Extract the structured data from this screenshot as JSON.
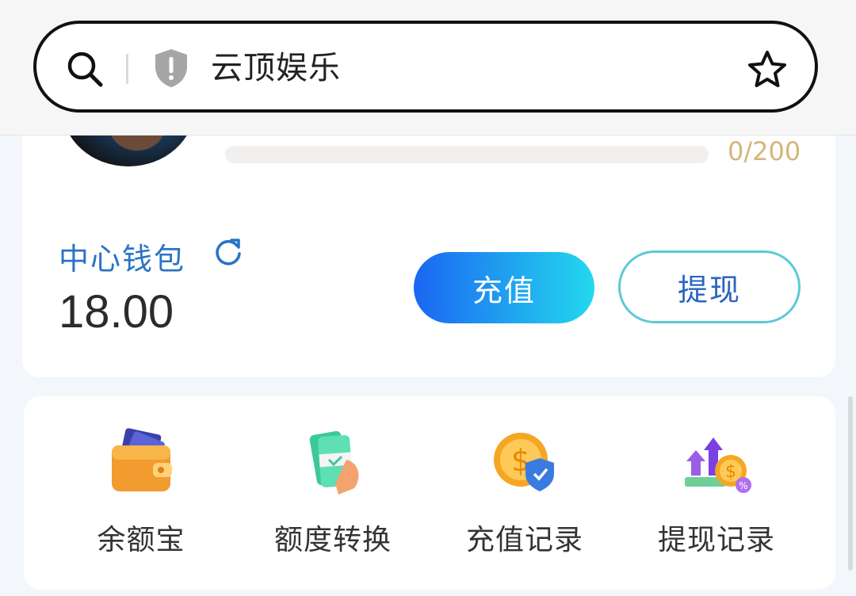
{
  "browser": {
    "url_text": "云顶娱乐",
    "icons": {
      "search": "search-icon",
      "security": "shield-icon",
      "bookmark": "star-icon"
    }
  },
  "profile": {
    "progress_text": "0/200",
    "progress_fraction": 0
  },
  "wallet": {
    "label": "中心钱包",
    "balance": "18.00",
    "recharge_label": "充值",
    "withdraw_label": "提现"
  },
  "menu": {
    "items": [
      {
        "label": "余额宝",
        "icon": "wallet-icon"
      },
      {
        "label": "额度转换",
        "icon": "money-hand-icon"
      },
      {
        "label": "充值记录",
        "icon": "coin-shield-icon"
      },
      {
        "label": "提现记录",
        "icon": "growth-coins-icon"
      }
    ]
  },
  "colors": {
    "accent_blue": "#2a73c5",
    "gradient_start": "#1b66f2",
    "gradient_end": "#24d8ee",
    "progress_text": "#d3b67a"
  }
}
